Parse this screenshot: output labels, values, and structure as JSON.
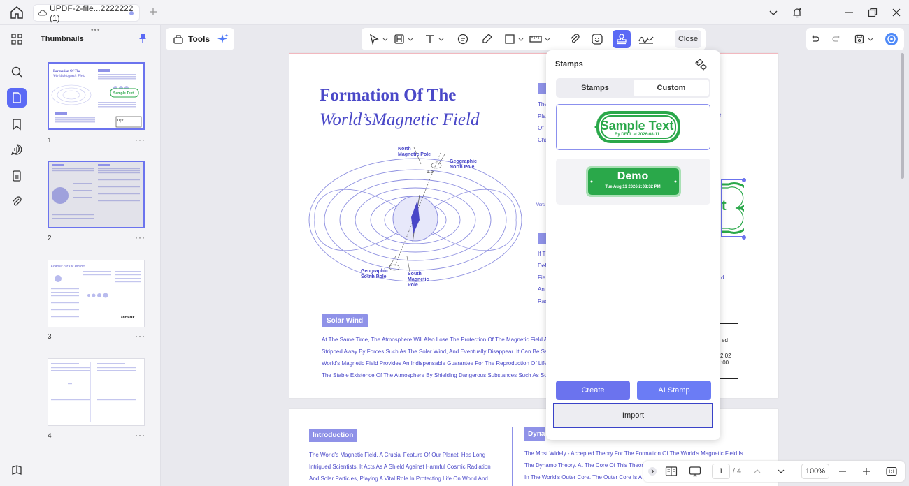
{
  "titlebar": {
    "tab_title": "UPDF-2-file...2222222 (1)"
  },
  "thumbnails": {
    "title": "Thumbnails",
    "pages": [
      {
        "num": "1",
        "more": "···"
      },
      {
        "num": "2",
        "more": "···"
      },
      {
        "num": "3",
        "more": "···"
      },
      {
        "num": "4",
        "more": "···"
      }
    ]
  },
  "toolbar": {
    "tools_label": "Tools",
    "close_label": "Close"
  },
  "page1": {
    "title_line1": "Formation Of The",
    "title_line2": "World’sMagnetic Field",
    "diagram_labels": {
      "north_magnetic": "North\nMagnetic Pole",
      "geographic_north": "Geographic\nNorth Pole",
      "geographic_south": "Geographic\nSouth Pole",
      "south_magnetic": "South\nMagnetic\nPole",
      "angle": "1.5"
    },
    "solar_wind_tag": "Solar Wind",
    "solar_wind_lines": [
      "At The Same Time, The Atmosphere Will Also Lose The Protection Of The Magnetic Field A",
      "Stripped Away By Forces Such As The Solar Wind, And Eventually Disappear. It Can Be Sa",
      "World's Magnetic Field Provides An Indispensable Guarantee For The Reproduction Of Life",
      "The Stable Existence Of The Atmosphere By Shielding Dangerous Substances Such As Sol"
    ],
    "right_column_fragments": [
      "The",
      "Pla",
      "Of",
      "Cha",
      "Vers",
      "If T",
      "Def",
      "Fie",
      "Ani",
      "Rac"
    ],
    "box_fragments": [
      "ed",
      "2.02",
      ":00"
    ],
    "side_fragments": [
      "t",
      "d"
    ],
    "stamp_fragment": "t"
  },
  "page2": {
    "intro_tag": "Introduction",
    "intro_lines": [
      "The World's Magnetic Field, A Crucial Feature Of Our Planet, Has Long",
      "Intrigued Scientists. It Acts As A Shield Against Harmful Cosmic Radiation",
      "And Solar Particles, Playing A Vital Role In Protecting Life On World And"
    ],
    "dyna_tag": "Dynamo",
    "dyna_lines": [
      "The Most Widely - Accepted Theory For The Formation Of The World's Magnetic Field Is",
      "The Dynamo Theory. At The Core Of This Theor",
      "In The World's Outer Core. The Outer Core Is A"
    ]
  },
  "stamps_panel": {
    "title": "Stamps",
    "tabs": [
      "Stamps",
      "Custom"
    ],
    "active_tab": "Custom",
    "stamp1": {
      "text": "Sample Text",
      "sub": "By DELL at 2026-08-11"
    },
    "stamp2": {
      "text": "Demo",
      "sub": "Tue Aug 11 2026 2:08:32 PM"
    },
    "create_label": "Create",
    "ai_stamp_label": "AI Stamp",
    "import_label": "Import"
  },
  "bottombar": {
    "current_page": "1",
    "total_pages": "/ 4",
    "zoom": "100%"
  },
  "colors": {
    "accent": "#5b6af5",
    "doc_text": "#4a48c8",
    "stamp_green": "#2aa84a"
  }
}
